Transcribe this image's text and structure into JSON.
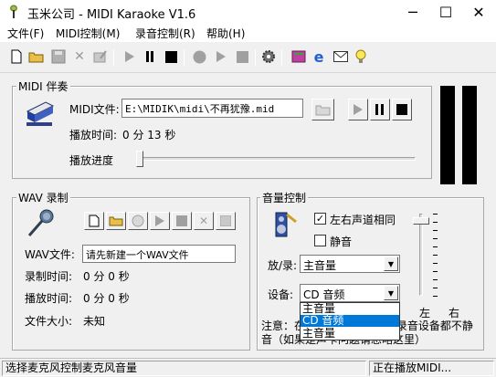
{
  "window": {
    "title": "玉米公司 - MIDI Karaoke V1.6",
    "minimize_glyph": "─",
    "maximize_glyph": "☐",
    "close_glyph": "✕"
  },
  "menu": [
    "文件(F)",
    "MIDI控制(M)",
    "录音控制(R)",
    "帮助(H)"
  ],
  "toolbar_icons": [
    "new-file-icon",
    "open-folder-icon",
    "save-icon",
    "delete-icon",
    "edit-icon",
    "play-icon",
    "pause-icon",
    "stop-icon",
    "record-icon",
    "play-icon",
    "stop-icon",
    "settings-icon",
    "book-icon",
    "internet-explorer-icon",
    "mail-icon",
    "lightbulb-icon"
  ],
  "midi": {
    "group_label": "MIDI 伴奏",
    "file_label": "MIDI文件:",
    "file_value": "E:\\MIDIK\\midi\\不再犹豫.mid",
    "time_label": "播放时间:",
    "time_value": "0 分 13 秒",
    "progress_label": "播放进度",
    "progress": 0.0
  },
  "wav": {
    "group_label": "WAV 录制",
    "file_label": "WAV文件:",
    "file_value": "请先新建一个WAV文件",
    "rec_time_label": "录制时间:",
    "rec_time_value": "0 分 0  秒",
    "play_time_label": "播放时间:",
    "play_time_value": "0 分 0  秒",
    "size_label": "文件大小:",
    "size_value": "未知"
  },
  "volume": {
    "group_label": "音量控制",
    "same_channel_label": "左右声道相同",
    "same_channel_checked": true,
    "mute_label": "静音",
    "mute_checked": false,
    "playrec_label": "放/录:",
    "playrec_value": "主音量",
    "device_label": "设备:",
    "device_value": "CD 音频",
    "device_options": [
      "主音量",
      "CD 音频",
      "主音量"
    ],
    "device_selected_index": 1,
    "left_label": "左",
    "right_label": "右",
    "note": "注意：在播放时,请确保所有录音设备都不静音（如果是声卡问题请忽略这里）",
    "slider_level": 0.95
  },
  "status": {
    "left": "选择麦克风控制麦克风音量",
    "right": "正在播放MIDI..."
  }
}
